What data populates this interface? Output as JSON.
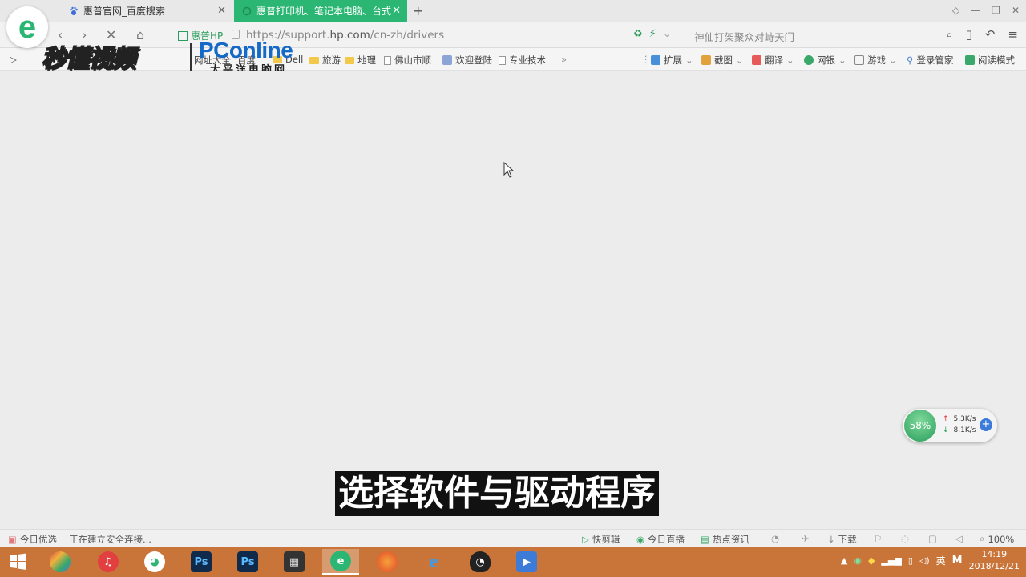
{
  "tabs": [
    {
      "label": "惠普官网_百度搜索"
    },
    {
      "label": "惠普打印机、笔记本电脑、台式"
    }
  ],
  "addressbar": {
    "site_chip": "惠普HP",
    "url_prefix": "https://support.",
    "url_domain": "hp.com",
    "url_path": "/cn-zh/drivers",
    "search_hint": "神仙打架聚众对峙天门"
  },
  "bookmarks": [
    {
      "label": "网址大全"
    },
    {
      "label": "百度"
    },
    {
      "label": "Dell"
    },
    {
      "label": "旅游"
    },
    {
      "label": "地理"
    },
    {
      "label": "佛山市顺"
    },
    {
      "label": "欢迎登陆"
    },
    {
      "label": "专业技术"
    }
  ],
  "toolbar_tools": [
    {
      "label": "扩展"
    },
    {
      "label": "截图"
    },
    {
      "label": "翻译"
    },
    {
      "label": "网银"
    },
    {
      "label": "游戏"
    },
    {
      "label": "登录管家"
    },
    {
      "label": "阅读模式"
    }
  ],
  "watermark": {
    "miaodong": "秒懂视频",
    "pconline": "PConline",
    "pconline_sub": "太平洋电脑网"
  },
  "speed_widget": {
    "percent": "58%",
    "upload": "5.3K/s",
    "download": "8.1K/s"
  },
  "subtitle": "选择软件与驱动程序",
  "statusbar": {
    "today_pick": "今日优选",
    "status_text": "正在建立安全连接...",
    "quick_clip": "快剪辑",
    "live": "今日直播",
    "hot_news": "热点资讯",
    "download": "下载",
    "zoom": "100%"
  },
  "taskbar": {
    "ime": "英",
    "time": "14:19",
    "date": "2018/12/21"
  }
}
